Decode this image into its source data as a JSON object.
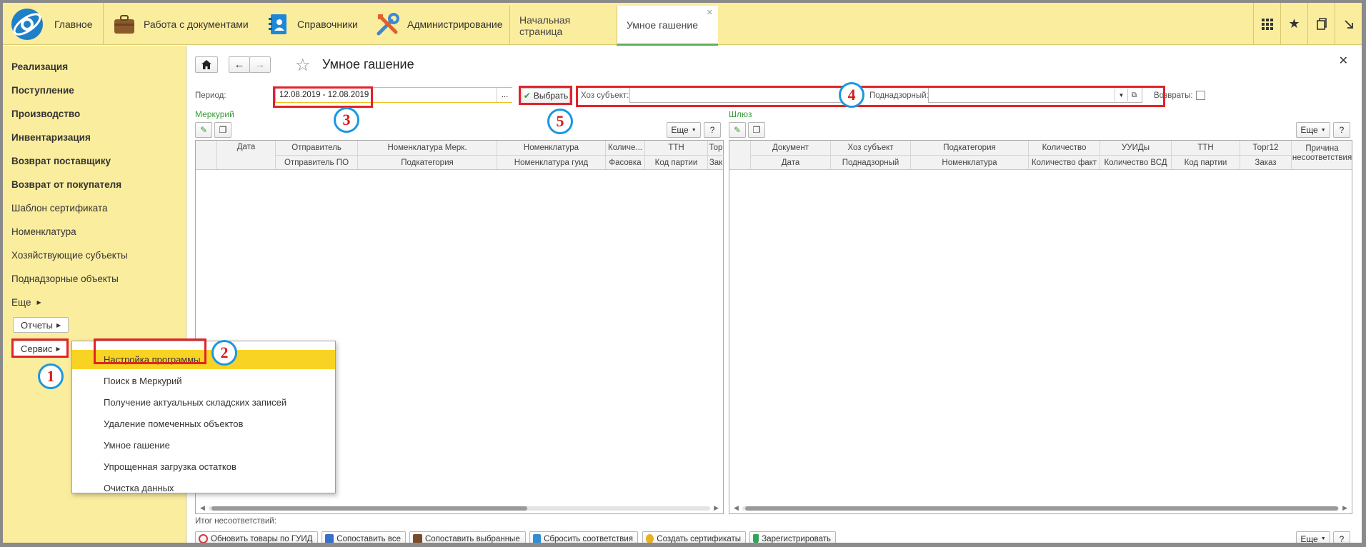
{
  "topbar": {
    "home_label": "Главное",
    "sections": [
      {
        "label": "Работа с документами",
        "icon": "briefcase-icon"
      },
      {
        "label": "Справочники",
        "icon": "address-book-icon"
      },
      {
        "label": "Администрирование",
        "icon": "tools-icon"
      }
    ],
    "tabs": [
      {
        "label": "Начальная страница",
        "active": false
      },
      {
        "label": "Умное гашение",
        "active": true
      }
    ]
  },
  "sidebar": {
    "items": [
      {
        "label": "Реализация",
        "bold": true
      },
      {
        "label": "Поступление",
        "bold": true
      },
      {
        "label": "Производство",
        "bold": true
      },
      {
        "label": "Инвентаризация",
        "bold": true
      },
      {
        "label": "Возврат поставщику",
        "bold": true
      },
      {
        "label": "Возврат от покупателя",
        "bold": true
      },
      {
        "label": "Шаблон сертификата",
        "bold": false
      },
      {
        "label": "Номенклатура",
        "bold": false
      },
      {
        "label": "Хозяйствующие субъекты",
        "bold": false
      },
      {
        "label": "Поднадзорные объекты",
        "bold": false
      }
    ],
    "more_label": "Еще",
    "reports_label": "Отчеты",
    "service_label": "Сервис"
  },
  "menu": {
    "items": [
      "Настройка программы",
      "Поиск в Меркурий",
      "Получение актуальных складских записей",
      "Удаление помеченных объектов",
      "Умное гашение",
      "Упрощенная загрузка остатков",
      "Очистка данных"
    ]
  },
  "form": {
    "title": "Умное гашение",
    "period_label": "Период:",
    "period_value": "12.08.2019 - 12.08.2019",
    "dots": "...",
    "select_label": "Выбрать",
    "subject_label": "Хоз субъект:",
    "subject_value": "",
    "supervised_label": "Поднадзорный:",
    "supervised_value": "",
    "returns_label": "Возвраты:"
  },
  "left_table": {
    "caption": "Меркурий",
    "more_label": "Еще",
    "help_label": "?",
    "header_row1": [
      "Дата",
      "Отправитель",
      "Номенклатура Мерк.",
      "Номенклатура",
      "Количе...",
      "ТТН",
      "Тор"
    ],
    "header_row2": [
      "Отправитель ПО",
      "Подкатегория",
      "Номенклатура гуид",
      "Фасовка",
      "Код партии",
      "Зак"
    ]
  },
  "right_table": {
    "caption": "Шлюз",
    "more_label": "Еще",
    "help_label": "?",
    "header_row1": [
      "Документ",
      "Хоз субъект",
      "Подкатегория",
      "Количество",
      "УУИДы",
      "ТТН",
      "Торг12"
    ],
    "header_row2": [
      "Дата",
      "Поднадзорный",
      "Номенклатура",
      "Количество факт",
      "Количество ВСД",
      "Код партии",
      "Заказ"
    ],
    "reason_header": "Причина несоответствия"
  },
  "footer": {
    "total_label": "Итог несоответствий:",
    "buttons": [
      {
        "label": "Обновить товары по ГУИД",
        "color": "#d9363e"
      },
      {
        "label": "Сопоставить все",
        "color": "#3a6fc9"
      },
      {
        "label": "Сопоставить выбранные",
        "color": "#7a4b2a"
      },
      {
        "label": "Сбросить соответствия",
        "color": "#2f8fd6"
      },
      {
        "label": "Создать сертификаты",
        "color": "#e8b21e"
      },
      {
        "label": "Зарегистрировать",
        "color": "#2fa55a"
      }
    ],
    "more_label": "Еще",
    "help_label": "?"
  },
  "annotations": [
    "1",
    "2",
    "3",
    "4",
    "5"
  ]
}
